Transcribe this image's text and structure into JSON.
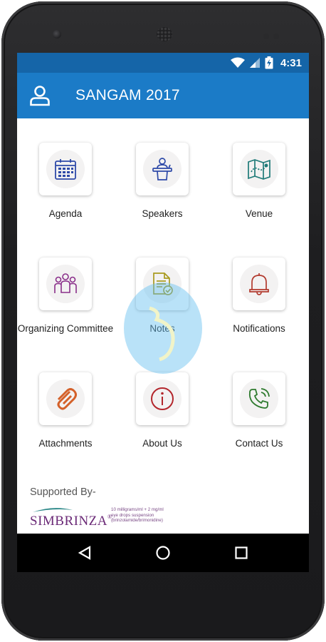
{
  "status_bar": {
    "time": "4:31",
    "bg_color": "#1565a8"
  },
  "app_bar": {
    "title": "SANGAM 2017",
    "bg_color": "#1b7bc7",
    "profile_icon": "person-icon"
  },
  "menu": [
    {
      "label": "Agenda",
      "icon": "calendar-icon"
    },
    {
      "label": "Speakers",
      "icon": "podium-speaker-icon"
    },
    {
      "label": "Venue",
      "icon": "map-icon"
    },
    {
      "label": "Organizing Committee",
      "icon": "group-icon"
    },
    {
      "label": "Notes",
      "icon": "notes-icon"
    },
    {
      "label": "Notifications",
      "icon": "bell-icon"
    },
    {
      "label": "Attachments",
      "icon": "paperclip-icon"
    },
    {
      "label": "About Us",
      "icon": "info-icon"
    },
    {
      "label": "Contact Us",
      "icon": "phone-icon"
    }
  ],
  "footer": {
    "supported_by": "Supported By-",
    "sponsor_brand": "SIMBRINZA",
    "sponsor_reg": "®",
    "sponsor_fine_print": [
      "10 milligrams/ml + 2 mg/ml",
      "eye drops suspension",
      "(brinzolamide/brimonidine)"
    ]
  },
  "nav_bar": {
    "back": "back-icon",
    "home": "home-icon",
    "recents": "recents-icon"
  }
}
